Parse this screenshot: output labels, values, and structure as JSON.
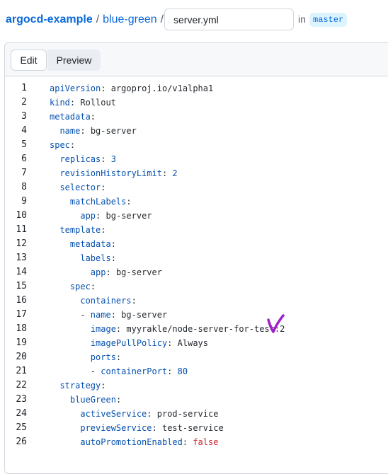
{
  "breadcrumb": {
    "repo": "argocd-example",
    "separator": "/",
    "folder": "blue-green",
    "separator2": "/"
  },
  "file": {
    "name": "server.yml"
  },
  "branch": {
    "in_label": "in",
    "name": "master"
  },
  "tabs": {
    "edit": "Edit",
    "preview": "Preview"
  },
  "annotation": {
    "icon": "checkmark-icon",
    "color": "#a020c8"
  },
  "colors": {
    "key": "#0550ae",
    "value": "#24292f",
    "bool": "#cf222e",
    "link": "#0969da"
  },
  "code": [
    {
      "n": "1",
      "indent": "",
      "key": "apiVersion",
      "value": "argoproj.io/v1alpha1",
      "type": "str"
    },
    {
      "n": "2",
      "indent": "",
      "key": "kind",
      "value": "Rollout",
      "type": "str"
    },
    {
      "n": "3",
      "indent": "",
      "key": "metadata",
      "value": "",
      "type": "str"
    },
    {
      "n": "4",
      "indent": "  ",
      "key": "name",
      "value": "bg-server",
      "type": "str"
    },
    {
      "n": "5",
      "indent": "",
      "key": "spec",
      "value": "",
      "type": "str"
    },
    {
      "n": "6",
      "indent": "  ",
      "key": "replicas",
      "value": "3",
      "type": "num"
    },
    {
      "n": "7",
      "indent": "  ",
      "key": "revisionHistoryLimit",
      "value": "2",
      "type": "num"
    },
    {
      "n": "8",
      "indent": "  ",
      "key": "selector",
      "value": "",
      "type": "str"
    },
    {
      "n": "9",
      "indent": "    ",
      "key": "matchLabels",
      "value": "",
      "type": "str"
    },
    {
      "n": "10",
      "indent": "      ",
      "key": "app",
      "value": "bg-server",
      "type": "str"
    },
    {
      "n": "11",
      "indent": "  ",
      "key": "template",
      "value": "",
      "type": "str"
    },
    {
      "n": "12",
      "indent": "    ",
      "key": "metadata",
      "value": "",
      "type": "str"
    },
    {
      "n": "13",
      "indent": "      ",
      "key": "labels",
      "value": "",
      "type": "str"
    },
    {
      "n": "14",
      "indent": "        ",
      "key": "app",
      "value": "bg-server",
      "type": "str"
    },
    {
      "n": "15",
      "indent": "    ",
      "key": "spec",
      "value": "",
      "type": "str"
    },
    {
      "n": "16",
      "indent": "      ",
      "key": "containers",
      "value": "",
      "type": "str"
    },
    {
      "n": "17",
      "indent": "      - ",
      "key": "name",
      "value": "bg-server",
      "type": "str"
    },
    {
      "n": "18",
      "indent": "        ",
      "key": "image",
      "value": "myyrakle/node-server-for-test:2",
      "type": "str"
    },
    {
      "n": "19",
      "indent": "        ",
      "key": "imagePullPolicy",
      "value": "Always",
      "type": "str"
    },
    {
      "n": "20",
      "indent": "        ",
      "key": "ports",
      "value": "",
      "type": "str"
    },
    {
      "n": "21",
      "indent": "        - ",
      "key": "containerPort",
      "value": "80",
      "type": "num"
    },
    {
      "n": "22",
      "indent": "  ",
      "key": "strategy",
      "value": "",
      "type": "str"
    },
    {
      "n": "23",
      "indent": "    ",
      "key": "blueGreen",
      "value": "",
      "type": "str"
    },
    {
      "n": "24",
      "indent": "      ",
      "key": "activeService",
      "value": "prod-service",
      "type": "str"
    },
    {
      "n": "25",
      "indent": "      ",
      "key": "previewService",
      "value": "test-service",
      "type": "str"
    },
    {
      "n": "26",
      "indent": "      ",
      "key": "autoPromotionEnabled",
      "value": "false",
      "type": "bool"
    }
  ]
}
